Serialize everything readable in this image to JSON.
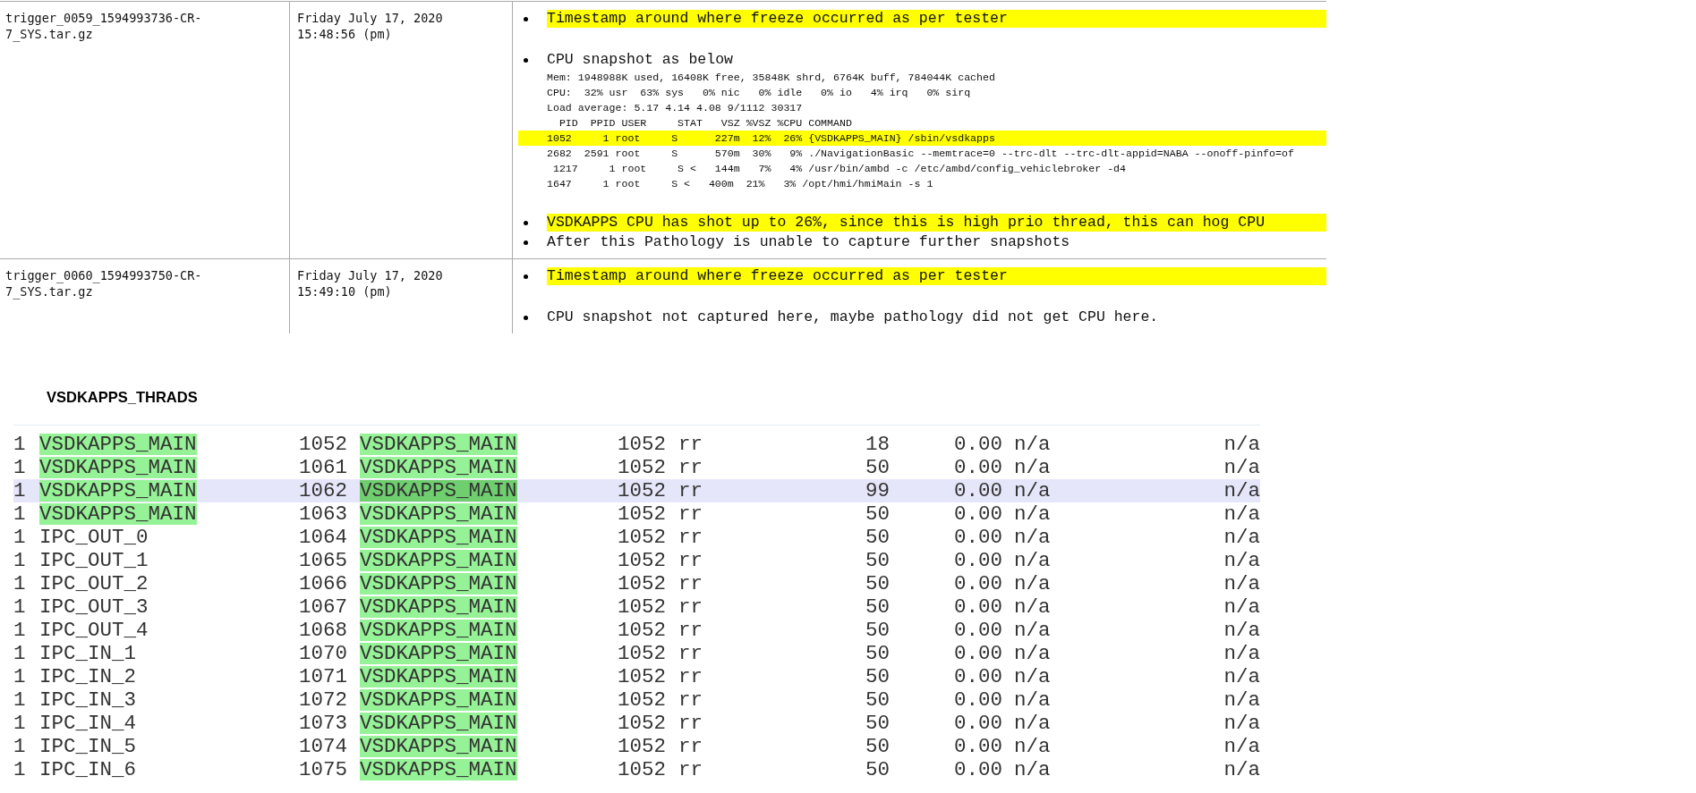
{
  "triggers": [
    {
      "file": "trigger_0059_1594993736-CR-7_SYS.tar.gz",
      "date": "Friday July 17, 2020",
      "time": "15:48:56 (pm)",
      "notes": [
        {
          "kind": "bullet",
          "text": "Timestamp around where freeze occurred as per tester",
          "highlighted": true
        },
        {
          "kind": "spacer"
        },
        {
          "kind": "bullet",
          "text": "CPU snapshot as below",
          "highlighted": false
        },
        {
          "kind": "snapshot",
          "lines": [
            {
              "text": "Mem: 1948988K used, 16408K free, 35848K shrd, 6764K buff, 784044K cached",
              "highlighted": false
            },
            {
              "text": "CPU:  32% usr  63% sys   0% nic   0% idle   0% io   4% irq   0% sirq",
              "highlighted": false
            },
            {
              "text": "Load average: 5.17 4.14 4.08 9/1112 30317",
              "highlighted": false
            },
            {
              "text": "  PID  PPID USER     STAT   VSZ %VSZ %CPU COMMAND",
              "highlighted": false
            },
            {
              "text": "1052     1 root     S      227m  12%  26% {VSDKAPPS_MAIN} /sbin/vsdkapps",
              "highlighted": true
            },
            {
              "text": "2682  2591 root     S      570m  30%   9% ./NavigationBasic --memtrace=0 --trc-dlt --trc-dlt-appid=NABA --onoff-pinfo=of",
              "highlighted": false
            },
            {
              "text": " 1217     1 root     S <   144m   7%   4% /usr/bin/ambd -c /etc/ambd/config_vehiclebroker -d4",
              "highlighted": false
            },
            {
              "text": "1647     1 root     S <   400m  21%   3% /opt/hmi/hmiMain -s 1",
              "highlighted": false
            }
          ]
        },
        {
          "kind": "spacer"
        },
        {
          "kind": "bullet",
          "text": "VSDKAPPS CPU has shot up to 26%, since this is high prio thread, this can hog CPU",
          "highlighted": true
        },
        {
          "kind": "bullet",
          "text": "After this Pathology is unable to capture further snapshots",
          "highlighted": false
        }
      ]
    },
    {
      "file": "trigger_0060_1594993750-CR-7_SYS.tar.gz",
      "date": "Friday July 17, 2020",
      "time": "15:49:10 (pm)",
      "notes": [
        {
          "kind": "bullet",
          "text": "Timestamp around where freeze occurred as per tester",
          "highlighted": true
        },
        {
          "kind": "spacer"
        },
        {
          "kind": "bullet",
          "text": "CPU snapshot not captured here, maybe pathology did not get CPU here.",
          "highlighted": false
        }
      ]
    }
  ],
  "threads": {
    "title": "VSDKAPPS_THRADS",
    "rows": [
      {
        "selected": false,
        "name_highlighted": true,
        "parent_highlighted": true,
        "cells": [
          "1",
          "VSDKAPPS_MAIN",
          "1052",
          "VSDKAPPS_MAIN",
          "1052",
          "rr",
          "18",
          "0.00",
          "n/a",
          "n/a"
        ]
      },
      {
        "selected": false,
        "name_highlighted": true,
        "parent_highlighted": true,
        "cells": [
          "1",
          "VSDKAPPS_MAIN",
          "1061",
          "VSDKAPPS_MAIN",
          "1052",
          "rr",
          "50",
          "0.00",
          "n/a",
          "n/a"
        ]
      },
      {
        "selected": true,
        "name_highlighted": true,
        "parent_highlighted": true,
        "cells": [
          "1",
          "VSDKAPPS_MAIN",
          "1062",
          "VSDKAPPS_MAIN",
          "1052",
          "rr",
          "99",
          "0.00",
          "n/a",
          "n/a"
        ]
      },
      {
        "selected": false,
        "name_highlighted": true,
        "parent_highlighted": true,
        "cells": [
          "1",
          "VSDKAPPS_MAIN",
          "1063",
          "VSDKAPPS_MAIN",
          "1052",
          "rr",
          "50",
          "0.00",
          "n/a",
          "n/a"
        ]
      },
      {
        "selected": false,
        "name_highlighted": false,
        "parent_highlighted": true,
        "cells": [
          "1",
          "IPC_OUT_0",
          "1064",
          "VSDKAPPS_MAIN",
          "1052",
          "rr",
          "50",
          "0.00",
          "n/a",
          "n/a"
        ]
      },
      {
        "selected": false,
        "name_highlighted": false,
        "parent_highlighted": true,
        "cells": [
          "1",
          "IPC_OUT_1",
          "1065",
          "VSDKAPPS_MAIN",
          "1052",
          "rr",
          "50",
          "0.00",
          "n/a",
          "n/a"
        ]
      },
      {
        "selected": false,
        "name_highlighted": false,
        "parent_highlighted": true,
        "cells": [
          "1",
          "IPC_OUT_2",
          "1066",
          "VSDKAPPS_MAIN",
          "1052",
          "rr",
          "50",
          "0.00",
          "n/a",
          "n/a"
        ]
      },
      {
        "selected": false,
        "name_highlighted": false,
        "parent_highlighted": true,
        "cells": [
          "1",
          "IPC_OUT_3",
          "1067",
          "VSDKAPPS_MAIN",
          "1052",
          "rr",
          "50",
          "0.00",
          "n/a",
          "n/a"
        ]
      },
      {
        "selected": false,
        "name_highlighted": false,
        "parent_highlighted": true,
        "cells": [
          "1",
          "IPC_OUT_4",
          "1068",
          "VSDKAPPS_MAIN",
          "1052",
          "rr",
          "50",
          "0.00",
          "n/a",
          "n/a"
        ]
      },
      {
        "selected": false,
        "name_highlighted": false,
        "parent_highlighted": true,
        "cells": [
          "1",
          "IPC_IN_1",
          "1070",
          "VSDKAPPS_MAIN",
          "1052",
          "rr",
          "50",
          "0.00",
          "n/a",
          "n/a"
        ]
      },
      {
        "selected": false,
        "name_highlighted": false,
        "parent_highlighted": true,
        "cells": [
          "1",
          "IPC_IN_2",
          "1071",
          "VSDKAPPS_MAIN",
          "1052",
          "rr",
          "50",
          "0.00",
          "n/a",
          "n/a"
        ]
      },
      {
        "selected": false,
        "name_highlighted": false,
        "parent_highlighted": true,
        "cells": [
          "1",
          "IPC_IN_3",
          "1072",
          "VSDKAPPS_MAIN",
          "1052",
          "rr",
          "50",
          "0.00",
          "n/a",
          "n/a"
        ]
      },
      {
        "selected": false,
        "name_highlighted": false,
        "parent_highlighted": true,
        "cells": [
          "1",
          "IPC_IN_4",
          "1073",
          "VSDKAPPS_MAIN",
          "1052",
          "rr",
          "50",
          "0.00",
          "n/a",
          "n/a"
        ]
      },
      {
        "selected": false,
        "name_highlighted": false,
        "parent_highlighted": true,
        "cells": [
          "1",
          "IPC_IN_5",
          "1074",
          "VSDKAPPS_MAIN",
          "1052",
          "rr",
          "50",
          "0.00",
          "n/a",
          "n/a"
        ]
      },
      {
        "selected": false,
        "name_highlighted": false,
        "parent_highlighted": true,
        "cells": [
          "1",
          "IPC_IN_6",
          "1075",
          "VSDKAPPS_MAIN",
          "1052",
          "rr",
          "50",
          "0.00",
          "n/a",
          "n/a"
        ]
      }
    ]
  }
}
